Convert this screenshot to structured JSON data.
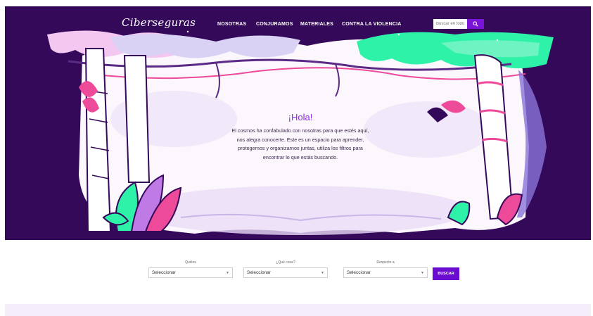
{
  "header": {
    "logo": "Ciberseguras",
    "nav": [
      "NOSOTRAS",
      "CONJURAMOS",
      "MATERIALES",
      "CONTRA LA VIOLENCIA"
    ],
    "search_placeholder": "Buscar en todo"
  },
  "intro": {
    "title": "¡Hola!",
    "lines": [
      "El cosmos ha confabulado con nosotras para que estés aquí,",
      "nos alegra conocerte. Este es un espacio para aprender,",
      "protegernos y organizarnos juntas, utiliza los filtros para",
      "encontrar lo que estás buscando."
    ]
  },
  "filters": [
    {
      "label": "Quiéns",
      "value": "Seleccionar"
    },
    {
      "label": "¿Qué cosa?",
      "value": "Seleccionar"
    },
    {
      "label": "Respecto a",
      "value": "Seleccionar"
    }
  ],
  "buscar_label": "BUSCAR",
  "colors": {
    "hero_bg": "#35095a",
    "accent": "#6a0dd0",
    "title": "#8a2be2",
    "mint": "#2ef2a8",
    "pink": "#ee4a9a"
  },
  "icons": {
    "search": "search-icon",
    "caret": "chevron-down-icon"
  }
}
